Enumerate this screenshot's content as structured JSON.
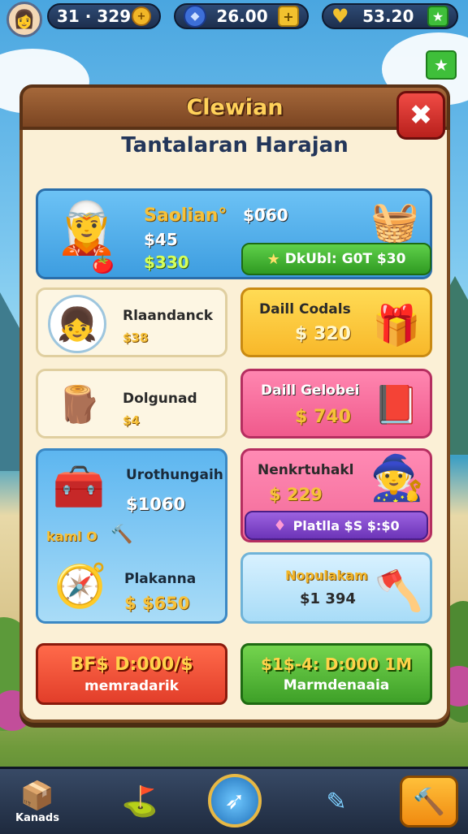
{
  "top_bar": {
    "coins": "31 · 329",
    "gems": "26.00",
    "hearts": "53.20"
  },
  "panel": {
    "title": "Clewian",
    "subtitle": "Tantalaran Harajan"
  },
  "featured": {
    "name": "Saolian°",
    "tag": "$0̅60",
    "price1": "$45",
    "price2": "$330",
    "buy_button": "DkUbl: G0T $30"
  },
  "items": {
    "left1": {
      "name": "Rlaandanck",
      "price": "$38"
    },
    "left2": {
      "name": "Dolgunad",
      "price": "$4"
    },
    "right1": {
      "name": "Daill Codals",
      "price": "$ 320"
    },
    "right2": {
      "name": "Daill Gelobei",
      "price": "$ 740"
    },
    "left3": {
      "name": "Urothungaih",
      "price": "$1060",
      "tag": "kaml O"
    },
    "left4": {
      "name": "Plakanna",
      "price": "$ $650"
    },
    "right3": {
      "name": "Nenkrtuhakl",
      "price": "$ 229",
      "sub_button": "Platlla $S $:$0"
    },
    "right4": {
      "name": "Nopulakam",
      "price": "$1 394"
    }
  },
  "action_buttons": {
    "red": {
      "top": "BF$ D:000/$",
      "bottom": "memradarik"
    },
    "green": {
      "top": "$1$-4: D:000 1M",
      "bottom": "Marmdenaaia"
    }
  },
  "bottom_nav": {
    "first_label": "Kanads"
  },
  "icons": {
    "coin": "coin-icon",
    "gem": "gem-icon",
    "heart": "heart-icon",
    "close": "close-icon"
  },
  "colors": {
    "blue_card": "#4fb0f0",
    "yellow_card": "#ffcd3a",
    "pink_card": "#ff6fa0",
    "purple_band": "#8a4fd0",
    "red_button": "#f04b3a",
    "green_button": "#55c43a"
  }
}
